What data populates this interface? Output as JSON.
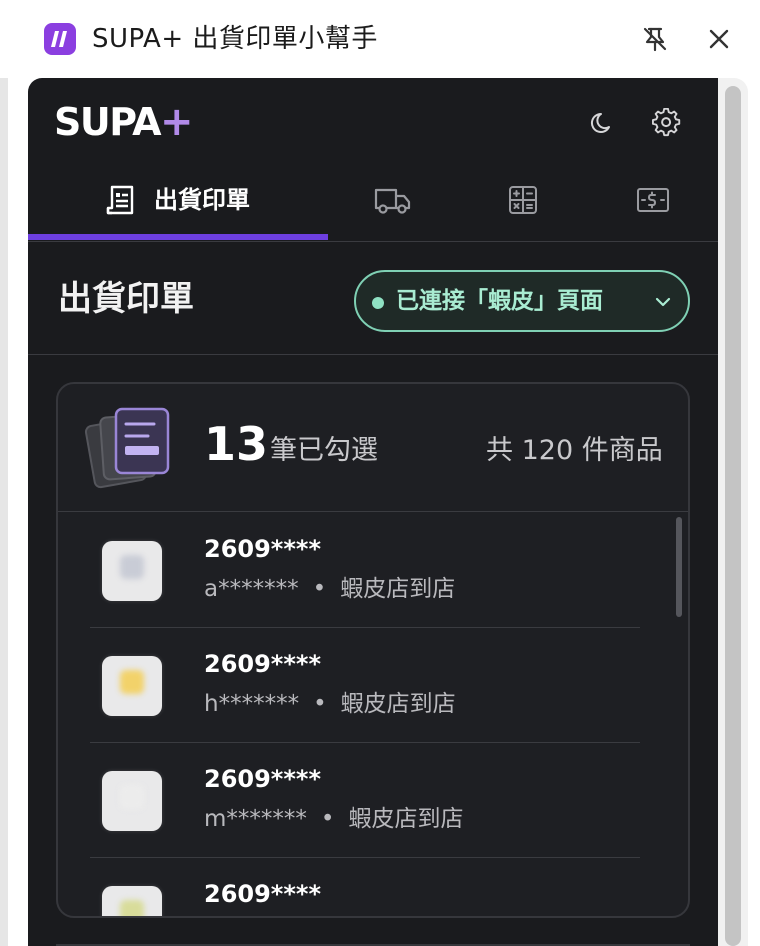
{
  "window": {
    "title": "SUPA+ 出貨印單小幫手"
  },
  "header": {
    "logo_text": "SUPA",
    "logo_plus": "+"
  },
  "tabs": [
    {
      "label": "出貨印單",
      "icon": "receipt-icon",
      "active": true
    },
    {
      "label": "",
      "icon": "truck-icon",
      "active": false
    },
    {
      "label": "",
      "icon": "calculator-icon",
      "active": false
    },
    {
      "label": "",
      "icon": "money-icon",
      "active": false
    }
  ],
  "section": {
    "title": "出貨印單",
    "connection_status": "已連接「蝦皮」頁面"
  },
  "summary": {
    "selected_count": "13",
    "selected_label": "筆已勾選",
    "total_label": "共 120 件商品"
  },
  "orders": [
    {
      "id": "2609****",
      "buyer": "a*******",
      "shipping": "蝦皮店到店",
      "thumb_color": "#c9ccd6"
    },
    {
      "id": "2609****",
      "buyer": "h*******",
      "shipping": "蝦皮店到店",
      "thumb_color": "#f2d26a"
    },
    {
      "id": "2609****",
      "buyer": "m*******",
      "shipping": "蝦皮店到店",
      "thumb_color": "#ececec"
    },
    {
      "id": "2609****",
      "buyer": "",
      "shipping": "",
      "thumb_color": "#d8dc9a"
    }
  ],
  "colors": {
    "accent": "#6d3fe0",
    "connected": "#8fe1c3",
    "panel_bg": "#1a1b1e"
  }
}
